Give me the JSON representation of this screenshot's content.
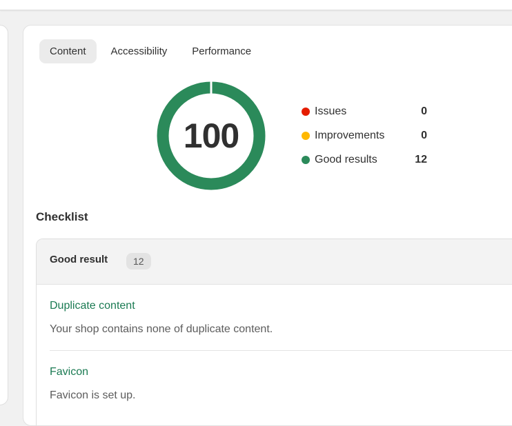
{
  "tabs": [
    {
      "label": "Content",
      "active": true
    },
    {
      "label": "Accessibility",
      "active": false
    },
    {
      "label": "Performance",
      "active": false
    }
  ],
  "score": {
    "value": "100",
    "fraction": 1.0,
    "ring_color": "#2b8a5a"
  },
  "legend": [
    {
      "label": "Issues",
      "count": "0",
      "color": "#e51c00"
    },
    {
      "label": "Improvements",
      "count": "0",
      "color": "#ffb800"
    },
    {
      "label": "Good results",
      "count": "12",
      "color": "#2b8a5a"
    }
  ],
  "checklist": {
    "title": "Checklist",
    "group_title": "Good result",
    "group_count": "12",
    "items": [
      {
        "title": "Duplicate content",
        "description": "Your shop contains none of duplicate content."
      },
      {
        "title": "Favicon",
        "description": "Favicon is set up."
      }
    ]
  }
}
